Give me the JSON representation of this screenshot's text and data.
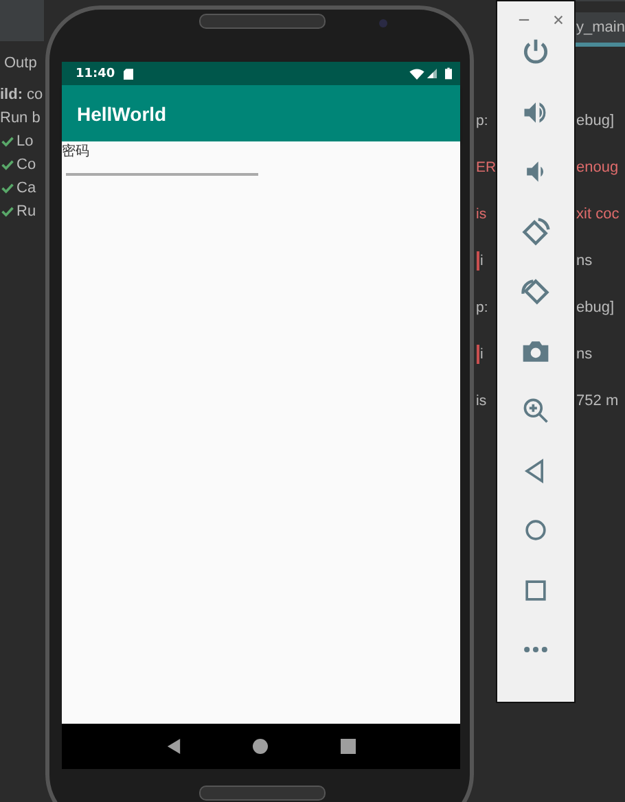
{
  "ide": {
    "output_tab": "Outp",
    "build_lines": [
      {
        "kind": "heading",
        "text": "**ild:** co"
      },
      {
        "kind": "text",
        "text": "Run b"
      },
      {
        "kind": "task",
        "text": "Lo"
      },
      {
        "kind": "task",
        "text": "Co"
      },
      {
        "kind": "task",
        "text": "Ca"
      },
      {
        "kind": "task",
        "text": "Ru"
      }
    ],
    "editor_tab": "y_main",
    "log_rows": [
      {
        "left": "p:",
        "right": "ebug]",
        "error": false,
        "marker": false
      },
      {
        "left": "ER",
        "right": "enoug",
        "error": true,
        "marker": false
      },
      {
        "left": "is",
        "right": "xit coc",
        "error": true,
        "marker": false
      },
      {
        "left": "i",
        "right": "ns",
        "error": false,
        "marker": true
      },
      {
        "left": "p:",
        "right": "ebug]",
        "error": false,
        "marker": false
      },
      {
        "left": "i",
        "right": "ns",
        "error": false,
        "marker": true
      },
      {
        "left": "is",
        "right": "752 m",
        "error": false,
        "marker": false
      }
    ]
  },
  "phone": {
    "status_bar": {
      "time": "11:40"
    },
    "app_bar": {
      "title": "HellWorld"
    },
    "field": {
      "label": "密码"
    }
  }
}
